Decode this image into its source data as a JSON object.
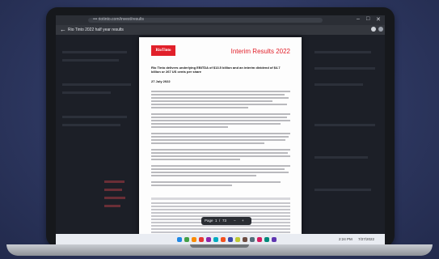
{
  "browser": {
    "url": "••• riotinto.com/invest/results",
    "window_controls": [
      "–",
      "□",
      "✕"
    ]
  },
  "viewer": {
    "document_title": "Rio Tinto 2022 half year results",
    "pager": {
      "label": "Page",
      "current": "1",
      "sep": "/",
      "total": "73",
      "minus": "−",
      "plus": "+"
    }
  },
  "pdf": {
    "logo": "RioTinto",
    "report_title": "Interim Results 2022",
    "headline": "Rio Tinto delivers underlying EBITDA of $13.5 billion and an interim dividend of $4.7 billion or 267 US cents per share",
    "date": "27 July 2022"
  },
  "taskbar": {
    "time": "2:24 PM",
    "date": "7/27/2022",
    "icon_colors": [
      "#1e88e5",
      "#43a047",
      "#fb8c00",
      "#e53935",
      "#8e24aa",
      "#00acc1",
      "#f4511e",
      "#3949ab",
      "#c0ca33",
      "#6d4c41",
      "#546e7a",
      "#d81b60",
      "#00897b",
      "#5e35b1"
    ]
  },
  "colors": {
    "brand_red": "#e1202a"
  }
}
